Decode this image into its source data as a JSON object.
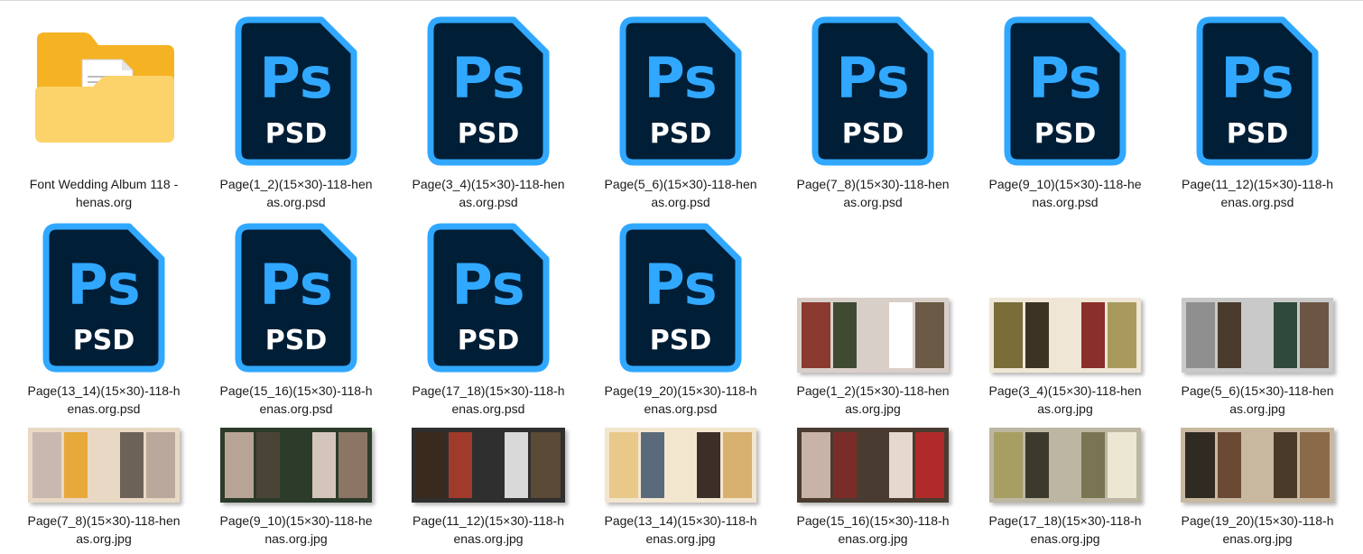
{
  "folder": {
    "label": "Font Wedding Album 118 -\nhenas.org"
  },
  "psd_icon_text": {
    "ps": "Ps",
    "ext": "PSD"
  },
  "colors": {
    "psd_bg": "#001e36",
    "psd_border": "#31a8ff",
    "psd_text": "#31a8ff",
    "psd_ext_text": "#ffffff",
    "folder_back": "#f5b324",
    "folder_front": "#fcd36a"
  },
  "psd_files": [
    "Page(1_2)(15×30)-118-hen\nas.org.psd",
    "Page(3_4)(15×30)-118-hen\nas.org.psd",
    "Page(5_6)(15×30)-118-hen\nas.org.psd",
    "Page(7_8)(15×30)-118-hen\nas.org.psd",
    "Page(9_10)(15×30)-118-he\nnas.org.psd",
    "Page(11_12)(15×30)-118-h\nenas.org.psd",
    "Page(13_14)(15×30)-118-h\nenas.org.psd",
    "Page(15_16)(15×30)-118-h\nenas.org.psd",
    "Page(17_18)(15×30)-118-h\nenas.org.psd",
    "Page(19_20)(15×30)-118-h\nenas.org.psd"
  ],
  "jpg_files": [
    {
      "label": "Page(1_2)(15×30)-118-hen\nas.org.jpg",
      "palette": [
        "#8b3a2f",
        "#3f4a33",
        "#d9cfc9",
        "#ffffff",
        "#6b5a45"
      ]
    },
    {
      "label": "Page(3_4)(15×30)-118-hen\nas.org.jpg",
      "palette": [
        "#7a6d3a",
        "#3d3324",
        "#efe6d6",
        "#8b2f2a",
        "#a89a5c"
      ]
    },
    {
      "label": "Page(5_6)(15×30)-118-hen\nas.org.jpg",
      "palette": [
        "#8f8f8f",
        "#4a3b2d",
        "#c9c9c9",
        "#2e4a3a",
        "#6b5646"
      ]
    },
    {
      "label": "Page(7_8)(15×30)-118-hen\nas.org.jpg",
      "palette": [
        "#c8b9b0",
        "#e7a93a",
        "#e9d9c4",
        "#6d6258",
        "#b9a89b"
      ]
    },
    {
      "label": "Page(9_10)(15×30)-118-he\nnas.org.jpg",
      "palette": [
        "#b8a497",
        "#4a4437",
        "#2d3b2a",
        "#d4c5bb",
        "#8b7565"
      ]
    },
    {
      "label": "Page(11_12)(15×30)-118-h\nenas.org.jpg",
      "palette": [
        "#3a2a1e",
        "#a03a2a",
        "#2f2f2f",
        "#d9d9d9",
        "#5a4a36"
      ]
    },
    {
      "label": "Page(13_14)(15×30)-118-h\nenas.org.jpg",
      "palette": [
        "#e8c98a",
        "#5a6a7a",
        "#f3e6cf",
        "#3b2f27",
        "#d8b070"
      ]
    },
    {
      "label": "Page(15_16)(15×30)-118-h\nenas.org.jpg",
      "palette": [
        "#c9b3a8",
        "#7a2d28",
        "#4a3b30",
        "#e6d8cf",
        "#b02a2a"
      ]
    },
    {
      "label": "Page(17_18)(15×30)-118-h\nenas.org.jpg",
      "palette": [
        "#a79e63",
        "#3c3a2c",
        "#bcb6a3",
        "#7b7452",
        "#ece7d3"
      ]
    },
    {
      "label": "Page(19_20)(15×30)-118-h\nenas.org.jpg",
      "palette": [
        "#2f2a22",
        "#6b4a34",
        "#c9b8a0",
        "#4a3a2a",
        "#8b6a4a"
      ]
    }
  ]
}
